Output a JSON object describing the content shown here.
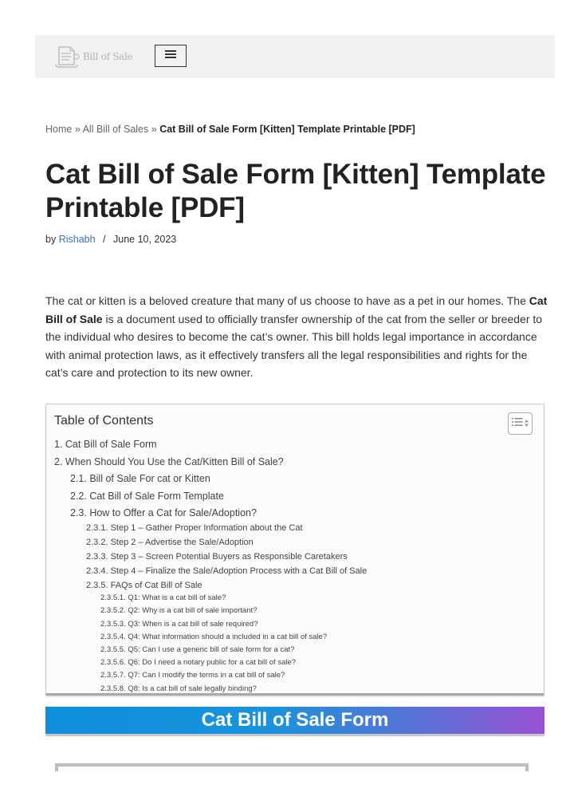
{
  "header": {
    "logo_text": "Bill of Sale",
    "menu_icon": "hamburger-icon"
  },
  "breadcrumb": {
    "home": "Home",
    "separator": "»",
    "category": "All Bill of Sales",
    "current": "Cat Bill of Sale Form [Kitten] Template Printable [PDF]"
  },
  "article": {
    "title": "Cat Bill of Sale Form [Kitten] Template Printable [PDF]",
    "by_label": "by",
    "author": "Rishabh",
    "meta_separator": "/",
    "date": "June 10, 2023",
    "intro_start": "The cat or kitten is a beloved creature that many of us choose to have as a pet in our homes. The ",
    "intro_bold": "Cat Bill of Sale",
    "intro_end": " is a document used to officially transfer ownership of the cat from the seller or breeder to the individual who desires to become the cat’s owner. This bill holds legal importance in accordance with animal protection laws, as it effectively transfers all the legal responsibilities and rights for the cat’s care and protection to its new owner."
  },
  "toc": {
    "title": "Table of Contents",
    "toggle_icon": "list-toggle-icon",
    "items": [
      {
        "level": 1,
        "label": "1. Cat Bill of Sale Form"
      },
      {
        "level": 1,
        "label": "2. When Should You Use the Cat/Kitten Bill of Sale?"
      },
      {
        "level": 2,
        "label": "2.1. Bill of Sale For cat or Kitten"
      },
      {
        "level": 2,
        "label": "2.2. Cat Bill of Sale Form Template"
      },
      {
        "level": 2,
        "label": "2.3. How to Offer a Cat for Sale/Adoption?"
      },
      {
        "level": 3,
        "label": "2.3.1. Step 1 – Gather Proper Information about the Cat"
      },
      {
        "level": 3,
        "label": "2.3.2. Step 2 – Advertise the Sale/Adoption"
      },
      {
        "level": 3,
        "label": "2.3.3. Step 3 – Screen Potential Buyers as Responsible Caretakers"
      },
      {
        "level": 3,
        "label": "2.3.4. Step 4 – Finalize the Sale/Adoption Process with a Cat Bill of Sale"
      },
      {
        "level": 3,
        "label": "2.3.5. FAQs of Cat Bill of Sale"
      },
      {
        "level": 4,
        "label": "2.3.5.1. Q1: What is a cat bill of sale?"
      },
      {
        "level": 4,
        "label": "2.3.5.2. Q2: Why is a cat bill of sale important?"
      },
      {
        "level": 4,
        "label": "2.3.5.3. Q3: When is a cat bill of sale required?"
      },
      {
        "level": 4,
        "label": "2.3.5.4. Q4: What information should a included in a cat bill of sale?"
      },
      {
        "level": 4,
        "label": "2.3.5.5. Q5: Can I use a generic bill of sale form for a cat?"
      },
      {
        "level": 4,
        "label": "2.3.5.6. Q6: Do I need a notary public for a cat bill of sale?"
      },
      {
        "level": 4,
        "label": "2.3.5.7. Q7: Can I modify the terms in a cat bill of sale?"
      },
      {
        "level": 4,
        "label": "2.3.5.8. Q8: Is a cat bill of sale legally binding?"
      }
    ]
  },
  "section": {
    "heading": "Cat Bill of Sale Form"
  },
  "colors": {
    "link": "#3c6fb5",
    "banner_start": "#0f8fdb",
    "banner_end": "#9a52d6",
    "header_bg": "#f1f1f1"
  }
}
